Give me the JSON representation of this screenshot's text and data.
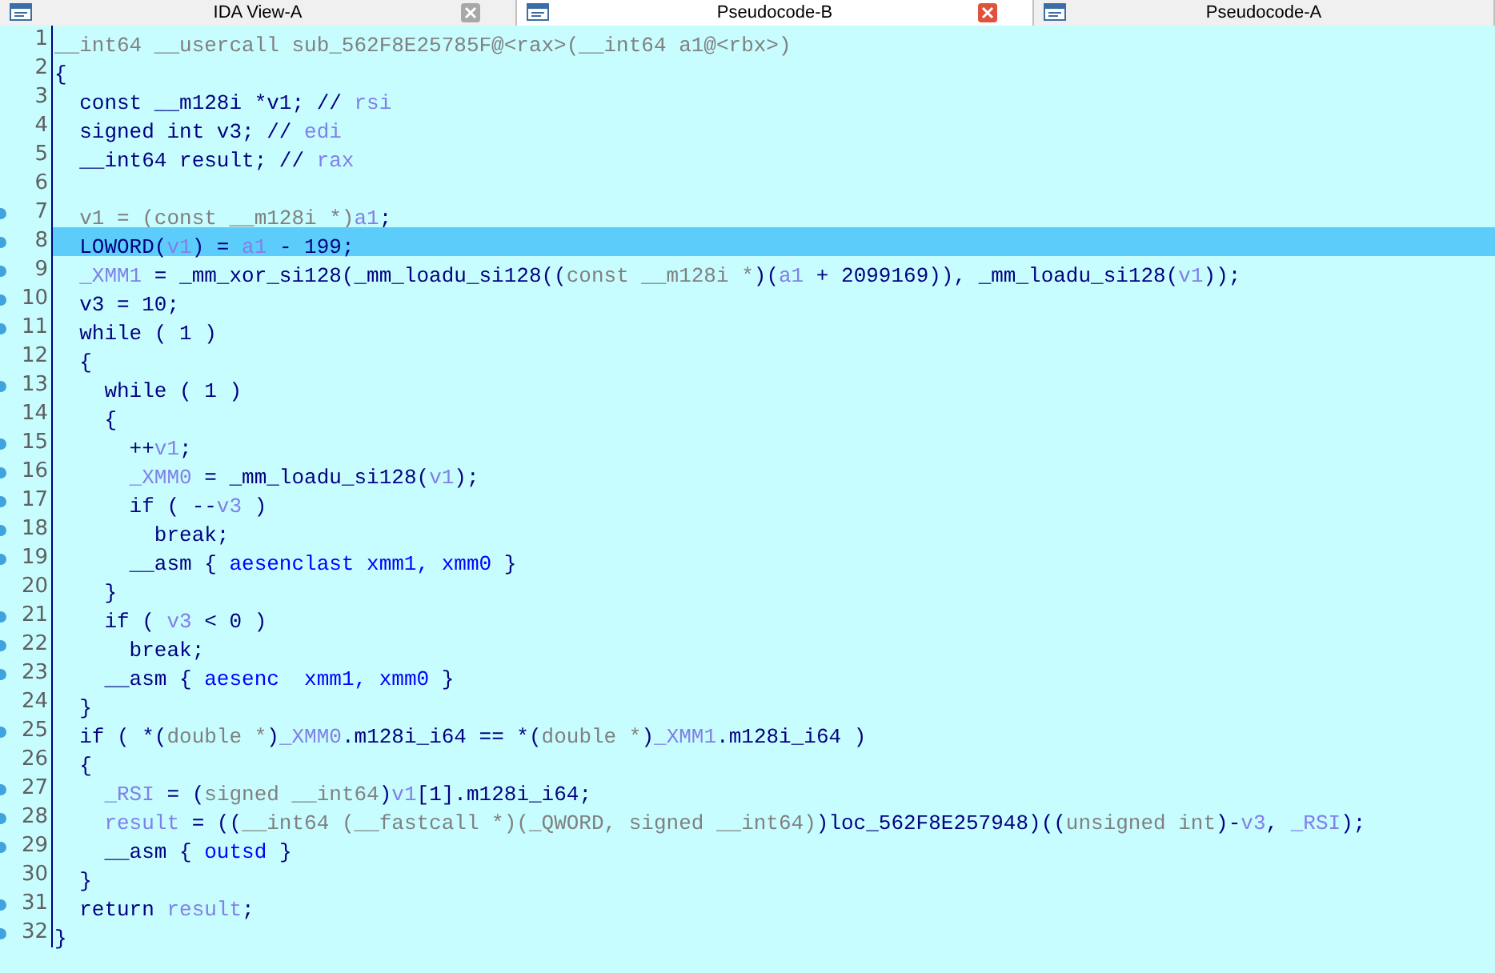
{
  "tabs": [
    {
      "label": "IDA View-A",
      "selected": false,
      "closable": true
    },
    {
      "label": "Pseudocode-B",
      "selected": true,
      "closable": true
    },
    {
      "label": "Pseudocode-A",
      "selected": false,
      "closable": false
    }
  ],
  "code": {
    "lines": [
      {
        "number": "1",
        "breakpoint": false,
        "selected": false,
        "segments": [
          {
            "kind": "cast",
            "text": "__int64 __usercall sub_562F8E25785F@<rax>(__int64 a1@<rbx>)"
          }
        ]
      },
      {
        "number": "2",
        "breakpoint": false,
        "selected": false,
        "segments": [
          {
            "kind": "code",
            "text": "{"
          }
        ]
      },
      {
        "number": "3",
        "breakpoint": false,
        "selected": false,
        "segments": [
          {
            "kind": "code",
            "text": "  const __m128i *v1; // "
          },
          {
            "kind": "var",
            "text": "rsi"
          }
        ]
      },
      {
        "number": "4",
        "breakpoint": false,
        "selected": false,
        "segments": [
          {
            "kind": "code",
            "text": "  signed int v3; // "
          },
          {
            "kind": "var",
            "text": "edi"
          }
        ]
      },
      {
        "number": "5",
        "breakpoint": false,
        "selected": false,
        "segments": [
          {
            "kind": "code",
            "text": "  __int64 result; // "
          },
          {
            "kind": "var",
            "text": "rax"
          }
        ]
      },
      {
        "number": "6",
        "breakpoint": false,
        "selected": false
      },
      {
        "number": "7",
        "breakpoint": true,
        "selected": false,
        "segments": [
          {
            "kind": "cast",
            "text": "  v1 = (const __m128i *)"
          },
          {
            "kind": "var",
            "text": "a1"
          },
          {
            "kind": "code",
            "text": ";"
          }
        ]
      },
      {
        "number": "8",
        "breakpoint": true,
        "selected": true,
        "segments": [
          {
            "kind": "code",
            "text": "  LOWORD("
          },
          {
            "kind": "var",
            "text": "v1"
          },
          {
            "kind": "code",
            "text": ") = "
          },
          {
            "kind": "var",
            "text": "a1"
          },
          {
            "kind": "code",
            "text": " - 199;"
          }
        ]
      },
      {
        "number": "9",
        "breakpoint": true,
        "selected": false,
        "segments": [
          {
            "kind": "var",
            "text": "  _XMM1"
          },
          {
            "kind": "code",
            "text": " = _mm_xor_si128(_mm_loadu_si128(("
          },
          {
            "kind": "cast",
            "text": "const __m128i *"
          },
          {
            "kind": "code",
            "text": ")("
          },
          {
            "kind": "var",
            "text": "a1"
          },
          {
            "kind": "code",
            "text": " + 2099169)), _mm_loadu_si128("
          },
          {
            "kind": "var",
            "text": "v1"
          },
          {
            "kind": "code",
            "text": "));"
          }
        ]
      },
      {
        "number": "10",
        "breakpoint": true,
        "selected": false,
        "segments": [
          {
            "kind": "code",
            "text": "  v3 = 10;"
          }
        ]
      },
      {
        "number": "11",
        "breakpoint": true,
        "selected": false,
        "segments": [
          {
            "kind": "code",
            "text": "  while ( 1 )"
          }
        ]
      },
      {
        "number": "12",
        "breakpoint": false,
        "selected": false,
        "segments": [
          {
            "kind": "code",
            "text": "  {"
          }
        ]
      },
      {
        "number": "13",
        "breakpoint": true,
        "selected": false,
        "segments": [
          {
            "kind": "code",
            "text": "    while ( 1 )"
          }
        ]
      },
      {
        "number": "14",
        "breakpoint": false,
        "selected": false,
        "segments": [
          {
            "kind": "code",
            "text": "    {"
          }
        ]
      },
      {
        "number": "15",
        "breakpoint": true,
        "selected": false,
        "segments": [
          {
            "kind": "code",
            "text": "      ++"
          },
          {
            "kind": "var",
            "text": "v1"
          },
          {
            "kind": "code",
            "text": ";"
          }
        ]
      },
      {
        "number": "16",
        "breakpoint": true,
        "selected": false,
        "segments": [
          {
            "kind": "var",
            "text": "      _XMM0"
          },
          {
            "kind": "code",
            "text": " = _mm_loadu_si128("
          },
          {
            "kind": "var",
            "text": "v1"
          },
          {
            "kind": "code",
            "text": ");"
          }
        ]
      },
      {
        "number": "17",
        "breakpoint": true,
        "selected": false,
        "segments": [
          {
            "kind": "code",
            "text": "      if ( --"
          },
          {
            "kind": "var",
            "text": "v3"
          },
          {
            "kind": "code",
            "text": " )"
          }
        ]
      },
      {
        "number": "18",
        "breakpoint": true,
        "selected": false,
        "segments": [
          {
            "kind": "code",
            "text": "        break;"
          }
        ]
      },
      {
        "number": "19",
        "breakpoint": true,
        "selected": false,
        "segments": [
          {
            "kind": "code",
            "text": "      __asm { "
          },
          {
            "kind": "asm",
            "text": "aesenclast xmm1, xmm0"
          },
          {
            "kind": "code",
            "text": " }"
          }
        ]
      },
      {
        "number": "20",
        "breakpoint": false,
        "selected": false,
        "segments": [
          {
            "kind": "code",
            "text": "    }"
          }
        ]
      },
      {
        "number": "21",
        "breakpoint": true,
        "selected": false,
        "segments": [
          {
            "kind": "code",
            "text": "    if ( "
          },
          {
            "kind": "var",
            "text": "v3"
          },
          {
            "kind": "code",
            "text": " < 0 )"
          }
        ]
      },
      {
        "number": "22",
        "breakpoint": true,
        "selected": false,
        "segments": [
          {
            "kind": "code",
            "text": "      break;"
          }
        ]
      },
      {
        "number": "23",
        "breakpoint": true,
        "selected": false,
        "segments": [
          {
            "kind": "code",
            "text": "    __asm { "
          },
          {
            "kind": "asm",
            "text": "aesenc  xmm1, xmm0"
          },
          {
            "kind": "code",
            "text": " }"
          }
        ]
      },
      {
        "number": "24",
        "breakpoint": false,
        "selected": false,
        "segments": [
          {
            "kind": "code",
            "text": "  }"
          }
        ]
      },
      {
        "number": "25",
        "breakpoint": true,
        "selected": false,
        "segments": [
          {
            "kind": "code",
            "text": "  if ( *("
          },
          {
            "kind": "cast",
            "text": "double *"
          },
          {
            "kind": "code",
            "text": ")"
          },
          {
            "kind": "var",
            "text": "_XMM0"
          },
          {
            "kind": "code",
            "text": ".m128i_i64 == *("
          },
          {
            "kind": "cast",
            "text": "double *"
          },
          {
            "kind": "code",
            "text": ")"
          },
          {
            "kind": "var",
            "text": "_XMM1"
          },
          {
            "kind": "code",
            "text": ".m128i_i64 )"
          }
        ]
      },
      {
        "number": "26",
        "breakpoint": false,
        "selected": false,
        "segments": [
          {
            "kind": "code",
            "text": "  {"
          }
        ]
      },
      {
        "number": "27",
        "breakpoint": true,
        "selected": false,
        "segments": [
          {
            "kind": "var",
            "text": "    _RSI"
          },
          {
            "kind": "code",
            "text": " = ("
          },
          {
            "kind": "cast",
            "text": "signed __int64"
          },
          {
            "kind": "code",
            "text": ")"
          },
          {
            "kind": "var",
            "text": "v1"
          },
          {
            "kind": "code",
            "text": "[1].m128i_i64;"
          }
        ]
      },
      {
        "number": "28",
        "breakpoint": true,
        "selected": false,
        "segments": [
          {
            "kind": "var",
            "text": "    result"
          },
          {
            "kind": "code",
            "text": " = (("
          },
          {
            "kind": "cast",
            "text": "__int64 (__fastcall *)(_QWORD, signed __int64)"
          },
          {
            "kind": "code",
            "text": ")loc_562F8E257948)(("
          },
          {
            "kind": "cast",
            "text": "unsigned int"
          },
          {
            "kind": "code",
            "text": ")-"
          },
          {
            "kind": "var",
            "text": "v3"
          },
          {
            "kind": "code",
            "text": ", "
          },
          {
            "kind": "var",
            "text": "_RSI"
          },
          {
            "kind": "code",
            "text": ");"
          }
        ]
      },
      {
        "number": "29",
        "breakpoint": true,
        "selected": false,
        "segments": [
          {
            "kind": "code",
            "text": "    __asm { "
          },
          {
            "kind": "asm",
            "text": "outsd"
          },
          {
            "kind": "code",
            "text": " }"
          }
        ]
      },
      {
        "number": "30",
        "breakpoint": false,
        "selected": false,
        "segments": [
          {
            "kind": "code",
            "text": "  }"
          }
        ]
      },
      {
        "number": "31",
        "breakpoint": true,
        "selected": false,
        "segments": [
          {
            "kind": "code",
            "text": "  return "
          },
          {
            "kind": "var",
            "text": "result"
          },
          {
            "kind": "code",
            "text": ";"
          }
        ]
      },
      {
        "number": "32",
        "breakpoint": true,
        "selected": false,
        "segments": [
          {
            "kind": "code",
            "text": "}"
          }
        ]
      }
    ]
  }
}
